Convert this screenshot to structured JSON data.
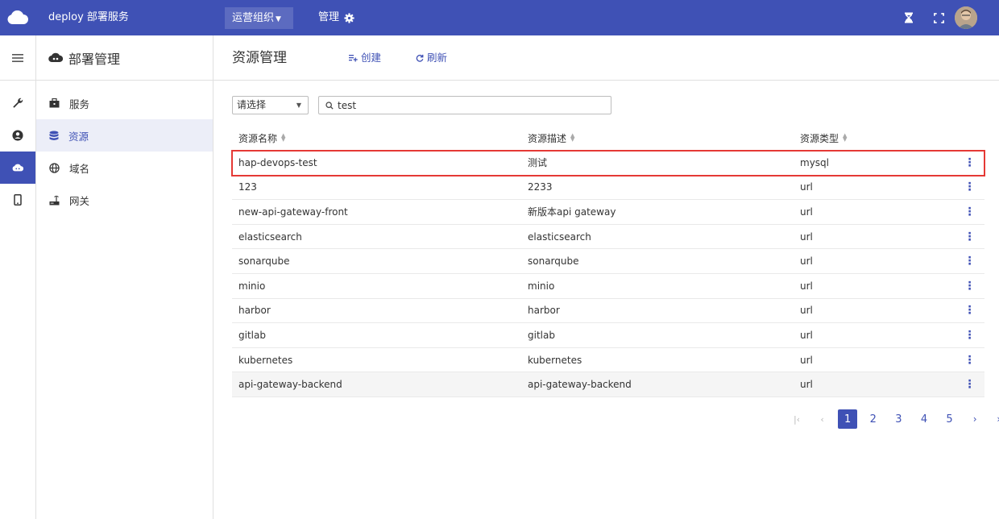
{
  "topbar": {
    "app_title": "deploy 部署服务",
    "org_label": "运营组织",
    "manage_label": "管理"
  },
  "menu": {
    "header": "部署管理",
    "items": [
      {
        "label": "服务",
        "icon": "briefcase-icon"
      },
      {
        "label": "资源",
        "icon": "database-icon"
      },
      {
        "label": "域名",
        "icon": "globe-icon"
      },
      {
        "label": "网关",
        "icon": "router-icon"
      }
    ]
  },
  "content": {
    "title": "资源管理",
    "create_label": "创建",
    "refresh_label": "刷新"
  },
  "filter": {
    "select_value": "请选择",
    "search_value": "test"
  },
  "table": {
    "headers": [
      "资源名称",
      "资源描述",
      "资源类型"
    ],
    "rows": [
      {
        "name": "hap-devops-test",
        "desc": "测试",
        "type": "mysql"
      },
      {
        "name": "123",
        "desc": "2233",
        "type": "url"
      },
      {
        "name": "new-api-gateway-front",
        "desc": "新版本api gateway",
        "type": "url"
      },
      {
        "name": "elasticsearch",
        "desc": "elasticsearch",
        "type": "url"
      },
      {
        "name": "sonarqube",
        "desc": "sonarqube",
        "type": "url"
      },
      {
        "name": "minio",
        "desc": "minio",
        "type": "url"
      },
      {
        "name": "harbor",
        "desc": "harbor",
        "type": "url"
      },
      {
        "name": "gitlab",
        "desc": "gitlab",
        "type": "url"
      },
      {
        "name": "kubernetes",
        "desc": "kubernetes",
        "type": "url"
      },
      {
        "name": "api-gateway-backend",
        "desc": "api-gateway-backend",
        "type": "url"
      }
    ]
  },
  "pager": {
    "pages": [
      "1",
      "2",
      "3",
      "4",
      "5"
    ],
    "current": "1"
  },
  "colors": {
    "primary": "#3f51b5",
    "highlight": "#e53935"
  }
}
